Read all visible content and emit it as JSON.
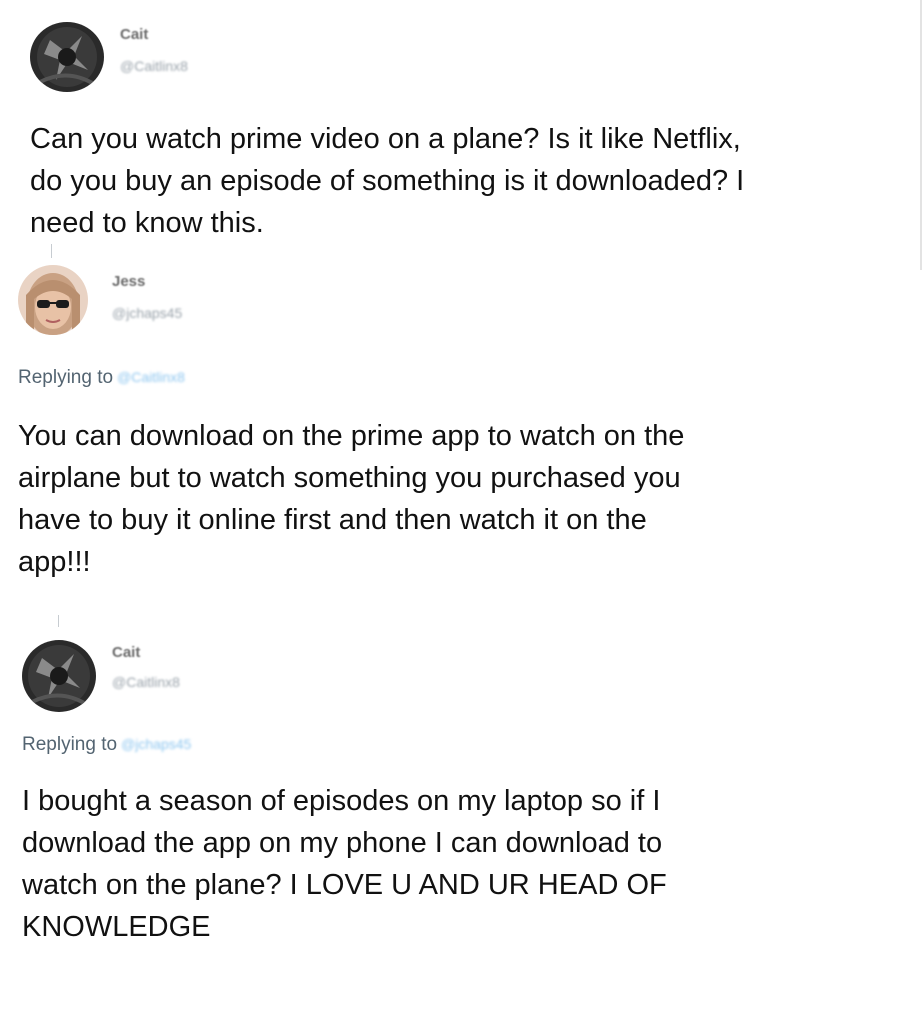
{
  "tweets": [
    {
      "display_name": "Cait",
      "handle": "@Caitlinx8",
      "body": "Can you watch prime video on a plane? Is it like Netflix,\ndo you buy an episode of something is it downloaded? I\nneed to know this."
    },
    {
      "display_name": "Jess",
      "handle": "@jchaps45",
      "replying_label": "Replying to",
      "replying_to": "@Caitlinx8",
      "body": "You can download on the prime app to watch on the\nairplane but to watch something you purchased you\nhave to buy it online first and then watch it on the\napp!!!"
    },
    {
      "display_name": "Cait",
      "handle": "@Caitlinx8",
      "replying_label": "Replying to",
      "replying_to": "@jchaps45",
      "body": "I bought a season of episodes on my laptop so if I\ndownload the app on my phone I can download to\nwatch on the plane? I LOVE U AND UR HEAD OF\nKNOWLEDGE"
    }
  ],
  "colors": {
    "body_text": "#111111",
    "secondary_text": "#536471",
    "mention": "#8ec6ef",
    "thread_line": "#c7ccd1"
  },
  "icons": {
    "avatar_1": "dark-grey-avatar",
    "avatar_2": "person-with-sunglasses-avatar",
    "avatar_3": "dark-grey-avatar"
  }
}
